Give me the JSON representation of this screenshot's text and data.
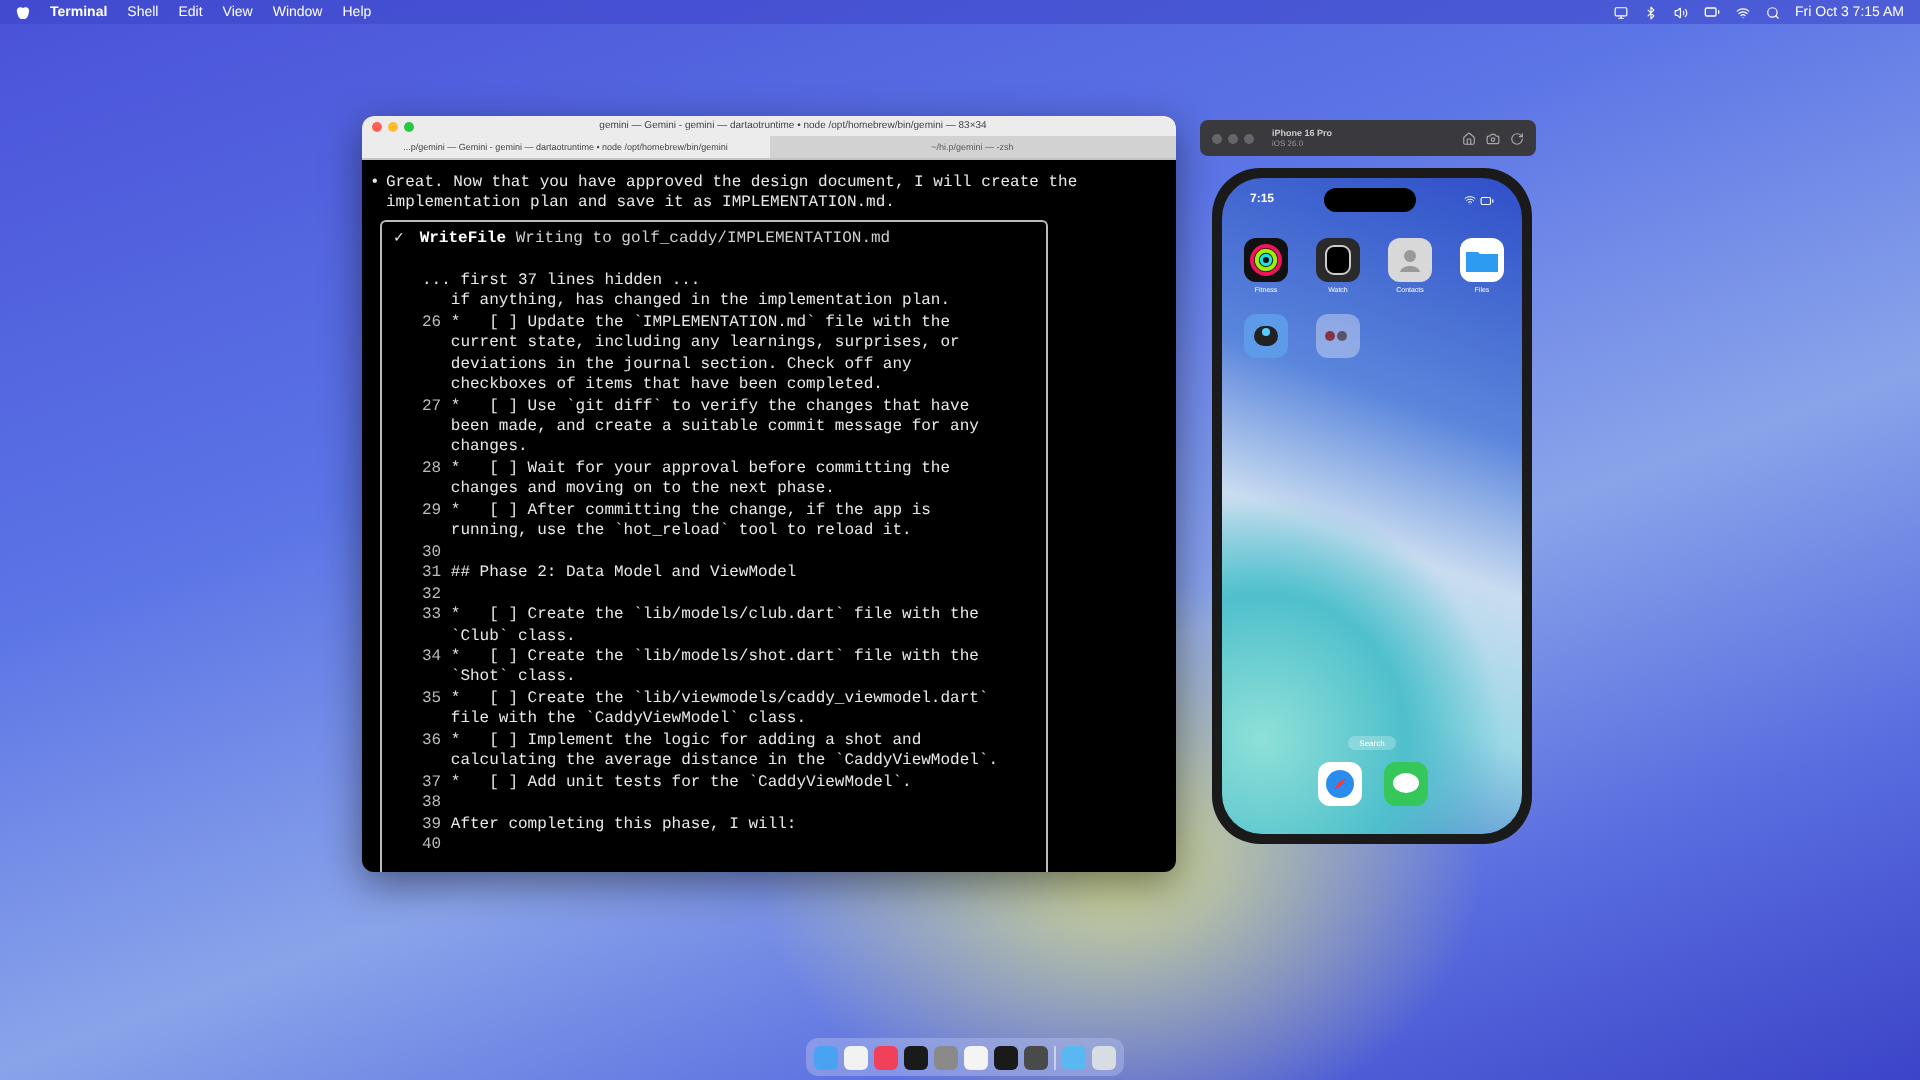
{
  "menu_bar": {
    "app": "Terminal",
    "items": [
      "Shell",
      "Edit",
      "View",
      "Window",
      "Help"
    ],
    "clock": "Fri Oct 3  7:15 AM"
  },
  "terminal": {
    "title": "gemini — Gemini - gemini — dartaotruntime • node /opt/homebrew/bin/gemini — 83×34",
    "tabs": [
      {
        "label": "...p/gemini — Gemini - gemini — dartaotruntime • node /opt/homebrew/bin/gemini",
        "selected": true
      },
      {
        "label": "~/hi.p/gemini — -zsh",
        "selected": false
      }
    ],
    "message": {
      "bullet": "•",
      "lines": [
        "Great. Now that you have approved the design document, I will create the",
        "implementation plan and save it as IMPLEMENTATION.md."
      ]
    },
    "tool": {
      "check": "✓",
      "name": "WriteFile",
      "description": "Writing to golf_caddy/IMPLEMENTATION.md",
      "hidden_note": "... first 37 lines hidden ...",
      "entries": [
        {
          "lines": [
            "if anything, has changed in the implementation plan."
          ]
        },
        {
          "num": "26",
          "lines": [
            "*   [ ] Update the `IMPLEMENTATION.md` file with the",
            "current state, including any learnings, surprises, or",
            "deviations in the journal section. Check off any",
            "checkboxes of items that have been completed."
          ]
        },
        {
          "num": "27",
          "lines": [
            "*   [ ] Use `git diff` to verify the changes that have",
            "been made, and create a suitable commit message for any",
            "changes."
          ]
        },
        {
          "num": "28",
          "lines": [
            "*   [ ] Wait for your approval before committing the",
            "changes and moving on to the next phase."
          ]
        },
        {
          "num": "29",
          "lines": [
            "*   [ ] After committing the change, if the app is",
            "running, use the `hot_reload` tool to reload it."
          ]
        },
        {
          "num": "30"
        },
        {
          "num": "31",
          "lines": [
            "## Phase 2: Data Model and ViewModel"
          ]
        },
        {
          "num": "32"
        },
        {
          "num": "33",
          "lines": [
            "*   [ ] Create the `lib/models/club.dart` file with the",
            "`Club` class."
          ]
        },
        {
          "num": "34",
          "lines": [
            "*   [ ] Create the `lib/models/shot.dart` file with the",
            "`Shot` class."
          ]
        },
        {
          "num": "35",
          "lines": [
            "*   [ ] Create the `lib/viewmodels/caddy_viewmodel.dart`",
            "file with the `CaddyViewModel` class."
          ]
        },
        {
          "num": "36",
          "lines": [
            "*   [ ] Implement the logic for adding a shot and",
            "calculating the average distance in the `CaddyViewModel`."
          ]
        },
        {
          "num": "37",
          "lines": [
            "*   [ ] Add unit tests for the `CaddyViewModel`."
          ]
        },
        {
          "num": "38"
        },
        {
          "num": "39",
          "lines": [
            "After completing this phase, I will:"
          ]
        },
        {
          "num": "40"
        }
      ]
    }
  },
  "simulator": {
    "device": "iPhone 16 Pro",
    "os": "iOS 26.0",
    "time": "7:15",
    "apps": [
      {
        "kind": "rings",
        "label": "Fitness"
      },
      {
        "kind": "watch",
        "label": "Watch"
      },
      {
        "kind": "contacts",
        "label": "Contacts"
      },
      {
        "kind": "files",
        "label": "Files"
      },
      {
        "kind": "robot"
      },
      {
        "kind": "folder"
      }
    ],
    "search": "Search",
    "dock": [
      {
        "kind": "compass"
      },
      {
        "kind": "messages"
      }
    ]
  },
  "dock": [
    {
      "kind": "finder"
    },
    {
      "kind": "chrome"
    },
    {
      "kind": "music"
    },
    {
      "kind": "terminal"
    },
    {
      "kind": "settings"
    },
    {
      "kind": "vscode"
    },
    {
      "kind": "terminal"
    },
    {
      "kind": "sublime"
    },
    {
      "kind": "folder"
    },
    {
      "kind": "trash"
    }
  ]
}
